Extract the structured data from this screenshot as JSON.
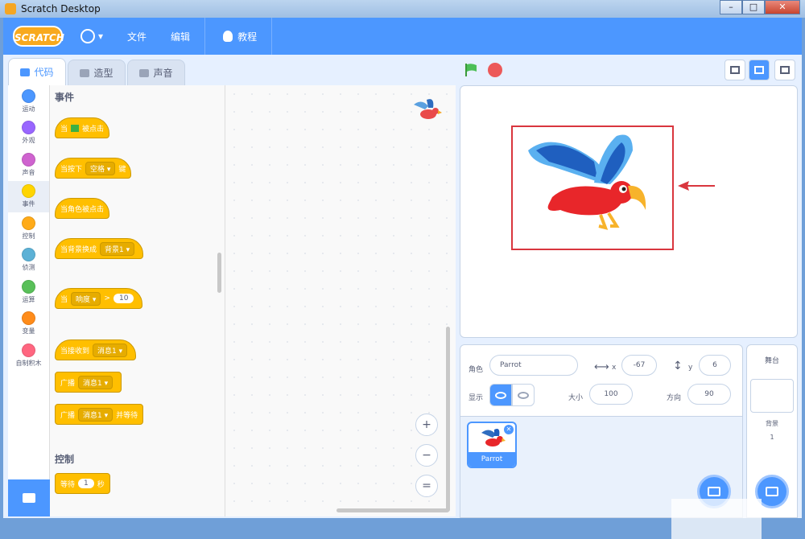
{
  "window": {
    "title": "Scratch Desktop",
    "min": "–",
    "max": "□",
    "close": "✕"
  },
  "menubar": {
    "logo": "SCRATCH",
    "file": "文件",
    "edit": "编辑",
    "tutorials": "教程"
  },
  "tabs": [
    {
      "label": "代码"
    },
    {
      "label": "造型"
    },
    {
      "label": "声音"
    }
  ],
  "categories": [
    {
      "label": "运动",
      "color": "#4c97ff"
    },
    {
      "label": "外观",
      "color": "#9966ff"
    },
    {
      "label": "声音",
      "color": "#cf63cf"
    },
    {
      "label": "事件",
      "color": "#ffd500"
    },
    {
      "label": "控制",
      "color": "#ffab19"
    },
    {
      "label": "侦测",
      "color": "#5cb1d6"
    },
    {
      "label": "运算",
      "color": "#59c059"
    },
    {
      "label": "变量",
      "color": "#ff8c1a"
    },
    {
      "label": "自制积木",
      "color": "#ff6680"
    }
  ],
  "palette": {
    "events_title": "事件",
    "b1": {
      "pre": "当",
      "post": "被点击"
    },
    "b2": {
      "pre": "当按下",
      "dd": "空格",
      "post": "键"
    },
    "b3": {
      "text": "当角色被点击"
    },
    "b4": {
      "pre": "当背景换成",
      "dd": "背景1"
    },
    "b5": {
      "pre": "当",
      "dd": "响度",
      "op": ">",
      "val": "10"
    },
    "b6": {
      "pre": "当接收到",
      "dd": "消息1"
    },
    "b7": {
      "pre": "广播",
      "dd": "消息1"
    },
    "b8": {
      "pre": "广播",
      "dd": "消息1",
      "post": "并等待"
    },
    "control_title": "控制",
    "b9": {
      "pre": "等待",
      "val": "1",
      "post": "秒"
    }
  },
  "zoom": {
    "in": "+",
    "out": "−",
    "reset": "="
  },
  "sprite_info": {
    "sprite_label": "角色",
    "sprite_name": "Parrot",
    "x_label": "x",
    "x": "-67",
    "y_label": "y",
    "y": "6",
    "show_label": "显示",
    "size_label": "大小",
    "size": "100",
    "direction_label": "方向",
    "direction": "90"
  },
  "sprite_list": [
    {
      "name": "Parrot"
    }
  ],
  "stage_panel": {
    "title": "舞台",
    "backdrops_label": "背景",
    "backdrops_count": "1"
  },
  "colors": {
    "accent": "#4c97ff",
    "event": "#ffbf00",
    "highlight_box": "#d9363e"
  }
}
